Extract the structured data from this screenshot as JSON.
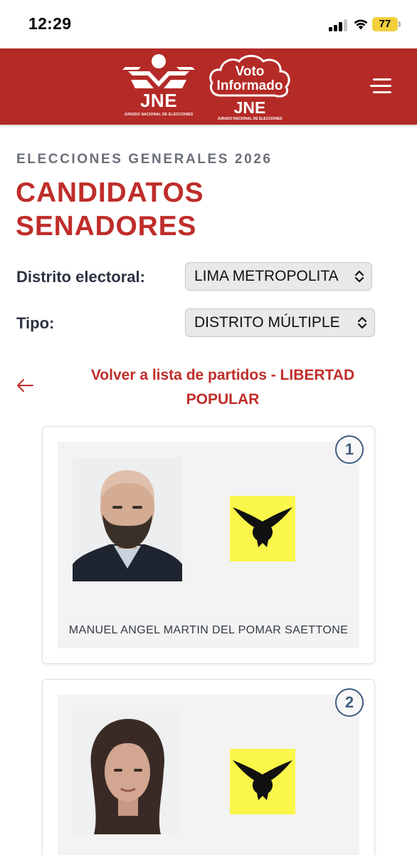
{
  "status_bar": {
    "time": "12:29",
    "battery": "77"
  },
  "header": {
    "jne_logo_text": "JNE",
    "jne_logo_subtitle": "JURADO NACIONAL DE ELECCIONES",
    "voto_line1": "Voto",
    "voto_line2": "Informado",
    "voto_jne": "JNE",
    "voto_subtitle": "JURADO NACIONAL DE ELECCIONES"
  },
  "page": {
    "eyebrow": "ELECCIONES GENERALES 2026",
    "title": "CANDIDATOS SENADORES"
  },
  "filters": {
    "distrito_label": "Distrito electoral:",
    "distrito_value": "LIMA METROPOLITA",
    "tipo_label": "Tipo:",
    "tipo_value": "DISTRITO MÚLTIPLE"
  },
  "back_link": {
    "text": "Volver a lista de partidos - LIBERTAD POPULAR"
  },
  "candidates": [
    {
      "number": "1",
      "name": "MANUEL ANGEL MARTIN DEL POMAR SAETTONE"
    },
    {
      "number": "2",
      "name": ""
    }
  ],
  "colors": {
    "brand_red": "#b42a26",
    "title_red": "#bf2d2a",
    "badge_blue": "#3f5e80",
    "party_yellow": "#fbf64a"
  },
  "icons": {
    "menu": "hamburger-menu-icon",
    "back": "arrow-left-icon",
    "select": "chevron-up-down-icon",
    "party": "eagle-party-logo"
  }
}
